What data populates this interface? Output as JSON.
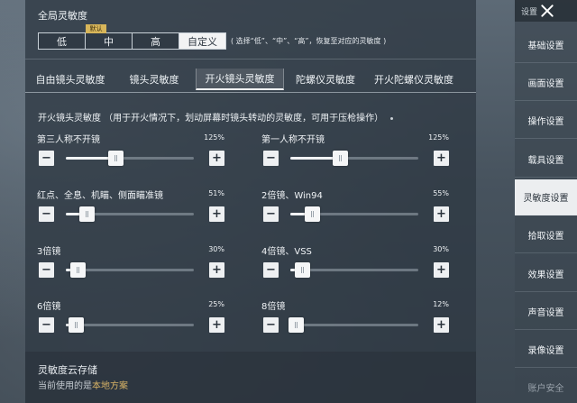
{
  "global": {
    "title": "全局灵敏度",
    "default_badge": "默认",
    "presets": [
      {
        "label": "低",
        "active": false
      },
      {
        "label": "中",
        "active": false
      },
      {
        "label": "高",
        "active": false
      },
      {
        "label": "自定义",
        "active": true
      }
    ],
    "hint": "( 选择“低”、“中”、“高”，恢复至对应的灵敏度 )"
  },
  "tabs": [
    {
      "label": "自由镜头灵敏度",
      "active": false
    },
    {
      "label": "镜头灵敏度",
      "active": false
    },
    {
      "label": "开火镜头灵敏度",
      "active": true
    },
    {
      "label": "陀螺仪灵敏度",
      "active": false
    },
    {
      "label": "开火陀螺仪灵敏度",
      "active": false
    }
  ],
  "section": {
    "desc": "开火镜头灵敏度 （用于开火情况下，划动屏幕时镜头转动的灵敏度，可用于压枪操作）"
  },
  "sliders": [
    {
      "label": "第三人称不开镜",
      "value_text": "125%",
      "fraction": 0.39
    },
    {
      "label": "第一人称不开镜",
      "value_text": "125%",
      "fraction": 0.39
    },
    {
      "label": "红点、全息、机瞄、侧面瞄准镜",
      "value_text": "51%",
      "fraction": 0.16
    },
    {
      "label": "2倍镜、Win94",
      "value_text": "55%",
      "fraction": 0.17
    },
    {
      "label": "3倍镜",
      "value_text": "30%",
      "fraction": 0.09
    },
    {
      "label": "4倍镜、VSS",
      "value_text": "30%",
      "fraction": 0.09
    },
    {
      "label": "6倍镜",
      "value_text": "25%",
      "fraction": 0.08
    },
    {
      "label": "8倍镜",
      "value_text": "12%",
      "fraction": 0.04
    }
  ],
  "controls": {
    "minus": "−",
    "plus": "+"
  },
  "cloud": {
    "title": "灵敏度云存储",
    "current_prefix": "当前使用的是",
    "current_value": "本地方案"
  },
  "sidebar": {
    "header": "设置",
    "items": [
      {
        "label": "基础设置",
        "active": false
      },
      {
        "label": "画面设置",
        "active": false
      },
      {
        "label": "操作设置",
        "active": false
      },
      {
        "label": "载具设置",
        "active": false
      },
      {
        "label": "灵敏度设置",
        "active": true
      },
      {
        "label": "拾取设置",
        "active": false
      },
      {
        "label": "效果设置",
        "active": false
      },
      {
        "label": "声音设置",
        "active": false
      },
      {
        "label": "录像设置",
        "active": false
      },
      {
        "label": "账户安全",
        "active": false
      }
    ]
  }
}
